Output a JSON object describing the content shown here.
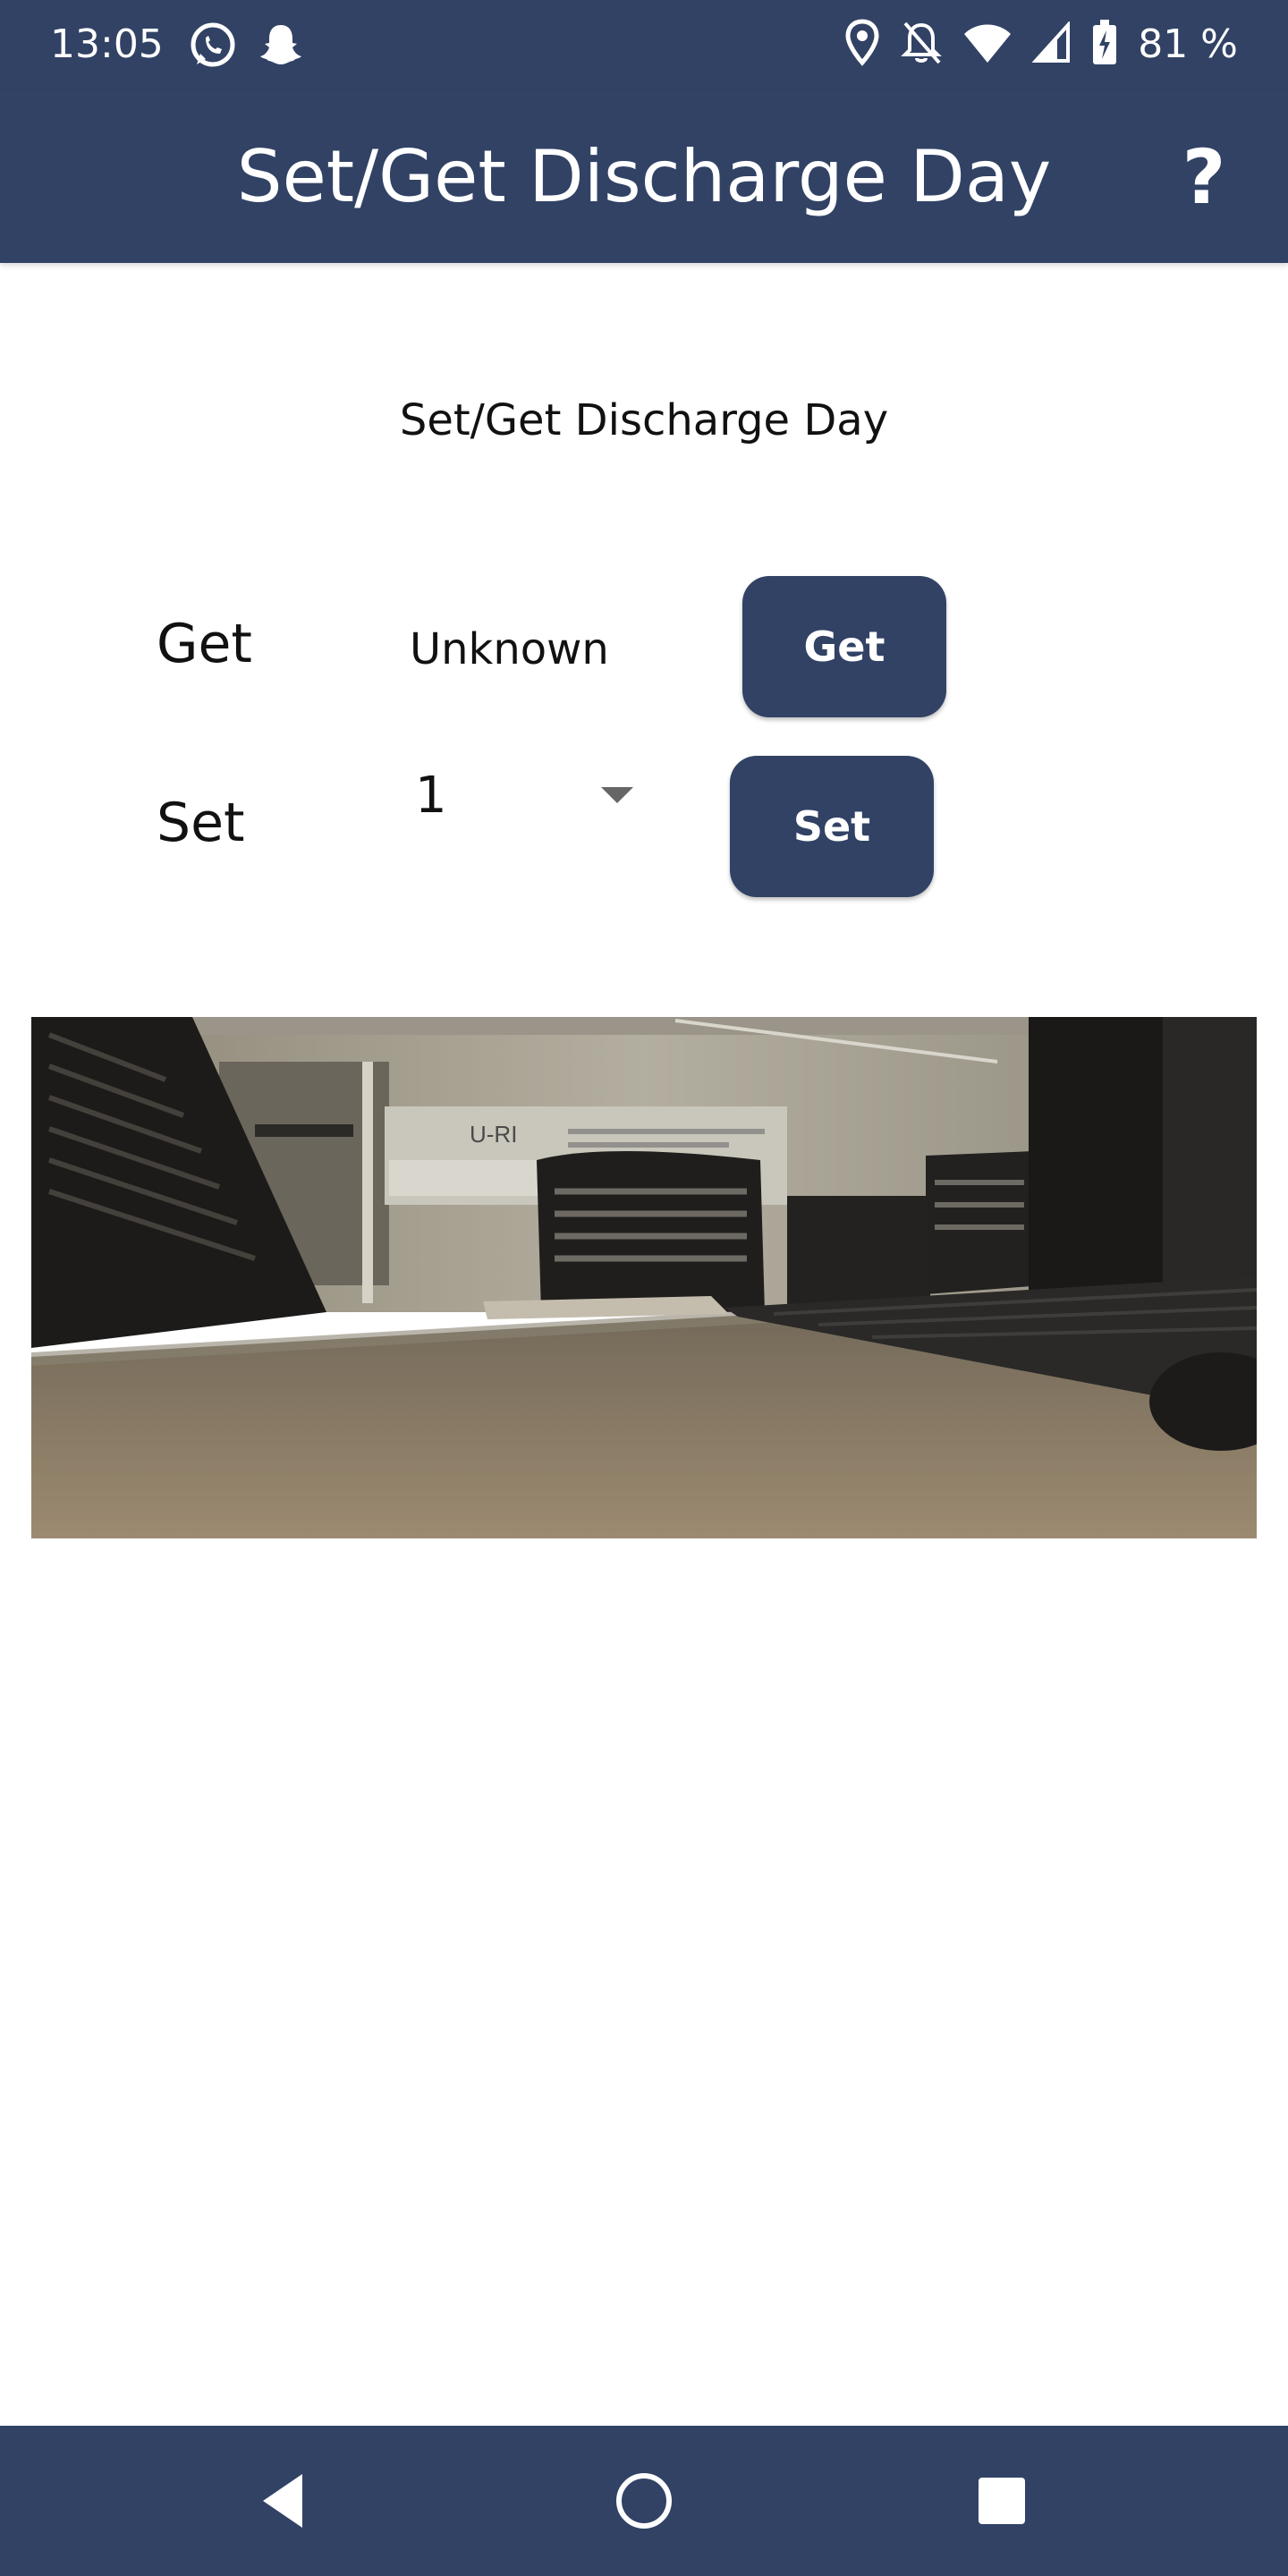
{
  "status_bar": {
    "time": "13:05",
    "battery_percent": "81 %",
    "left_icons": [
      "whatsapp-icon",
      "snapchat-icon"
    ],
    "right_icons": [
      "location-icon",
      "notifications-off-icon",
      "wifi-icon",
      "signal-icon",
      "battery-charging-icon"
    ]
  },
  "app_bar": {
    "title": "Set/Get Discharge Day",
    "help_icon": "help-icon",
    "help_symbol": "?"
  },
  "main": {
    "heading": "Set/Get Discharge Day",
    "get_row": {
      "label": "Get",
      "value": "Unknown",
      "button_label": "Get"
    },
    "set_row": {
      "label": "Set",
      "selected_value": "1",
      "button_label": "Set"
    },
    "image": "office-desk-photo"
  },
  "nav_bar": {
    "buttons": [
      "back-icon",
      "home-icon",
      "recent-apps-icon"
    ]
  },
  "colors": {
    "primary": "#314265",
    "background": "#ffffff",
    "text": "#111111"
  }
}
